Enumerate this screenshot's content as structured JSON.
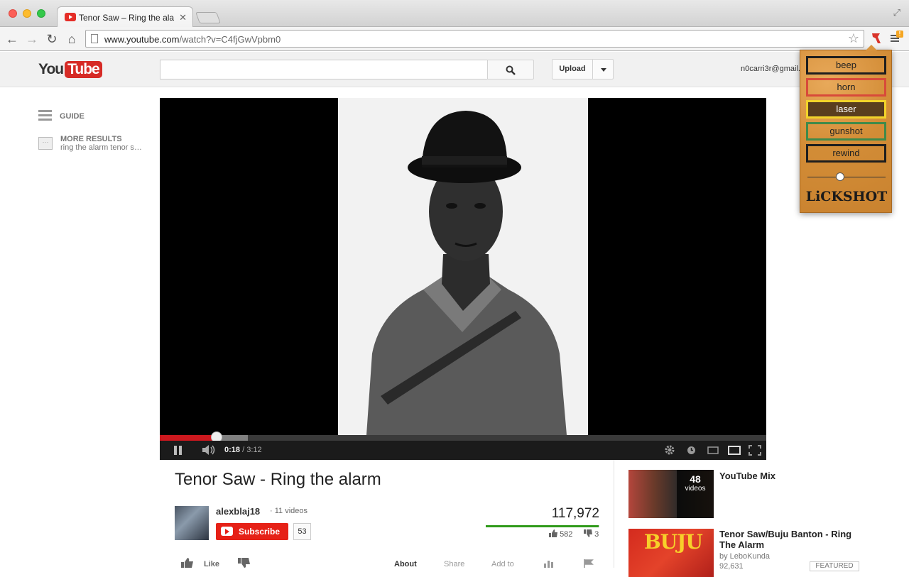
{
  "browser": {
    "tab_title": "Tenor Saw – Ring the ala",
    "url_host": "www.youtube.com",
    "url_path": "/watch?v=C4fjGwVpbm0"
  },
  "masthead": {
    "logo_you": "You",
    "logo_tube": "Tube",
    "search_placeholder": "",
    "upload_label": "Upload",
    "account": "n0carri3r@gmail."
  },
  "guide": {
    "guide_label": "GUIDE",
    "more_label": "MORE RESULTS",
    "more_sub": "ring the alarm tenor s…"
  },
  "player": {
    "current_time": "0:18",
    "duration": "/ 3:12",
    "played_fraction": 0.094,
    "buffered_fraction": 0.145
  },
  "lickshot": {
    "sounds": [
      {
        "label": "beep",
        "border": "#1e1e1e",
        "bg": "transparent",
        "color": "#222"
      },
      {
        "label": "horn",
        "border": "#d84a3a",
        "bg": "transparent",
        "color": "#222"
      },
      {
        "label": "laser",
        "border": "#f2d32a",
        "bg": "#5a3e1e",
        "color": "#ffffff"
      },
      {
        "label": "gunshot",
        "border": "#3f8a4a",
        "bg": "transparent",
        "color": "#222"
      },
      {
        "label": "rewind",
        "border": "#1e1e1e",
        "bg": "transparent",
        "color": "#222"
      }
    ],
    "volume_fraction": 0.42,
    "logo": "LiCKSHOT"
  },
  "video": {
    "title": "Tenor Saw - Ring the alarm",
    "owner": "alexblaj18",
    "owner_videos": "11 videos",
    "subscribe_label": "Subscribe",
    "subscriber_count": "53",
    "views": "117,972",
    "likes": "582",
    "dislikes": "3",
    "like_fraction": 0.995,
    "like_label": "Like",
    "actions": [
      "About",
      "Share",
      "Add to"
    ]
  },
  "related": [
    {
      "title": "YouTube Mix",
      "overlay_count": "48",
      "overlay_unit": "videos"
    },
    {
      "title": "Tenor Saw/Buju Banton - Ring The Alarm",
      "by": "by LeboKunda",
      "views": "92,631",
      "badge": "FEATURED",
      "thumb_text": "BUJU"
    }
  ]
}
